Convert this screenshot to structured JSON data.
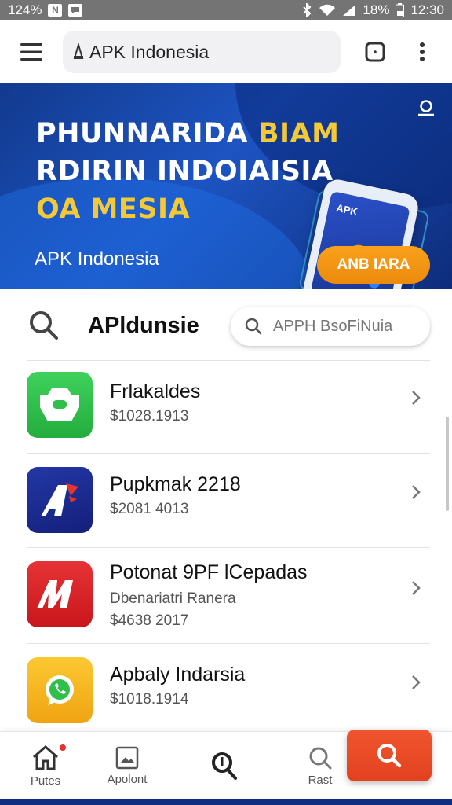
{
  "status_bar": {
    "left_text": "124%",
    "battery": "18%",
    "time": "12:30"
  },
  "app_bar": {
    "url_text": "APK Indonesia",
    "icons": [
      "menu-icon",
      "lock-icon",
      "tabs-icon",
      "more-vert-icon"
    ]
  },
  "banner": {
    "line1_white": "PHUNNARIDA ",
    "line1_yellow": "BIAM",
    "line2": "RDIRIN INDOIAISIA",
    "line3": "OA MESIA",
    "subtitle": "APK Indonesia",
    "cta_label": "ANB IARA",
    "phone_title": "APK",
    "colors": {
      "background": "#1d54c2",
      "accent_yellow": "#f3c938",
      "cta": "#f9a11c"
    }
  },
  "search": {
    "title": "APldunsie",
    "placeholder": "APPH BsoFiNuia"
  },
  "apps": [
    {
      "title": "Frlakaldes",
      "subtitle": "",
      "price": "$1028.1913",
      "icon_color": "#2fbf4a"
    },
    {
      "title": "Pupkmak 2218",
      "subtitle": "",
      "price": "$2081 4013",
      "icon_color": "#1c2a8f"
    },
    {
      "title": "Potonat 9PF lCepadas",
      "subtitle": "Dbenariatri Ranera",
      "price": "$4638 2017",
      "icon_color": "#d9262b"
    },
    {
      "title": "Apbaly Indarsia",
      "subtitle": "",
      "price": "$1018.1914",
      "icon_color": "#f5b81e"
    }
  ],
  "bottom_nav": {
    "items": [
      {
        "label": "Putes",
        "icon": "home-icon"
      },
      {
        "label": "Apolont",
        "icon": "gallery-icon"
      },
      {
        "label": "",
        "icon": "search-icon"
      },
      {
        "label": "Rast",
        "icon": "search-icon"
      }
    ],
    "fab_icon": "search-icon",
    "colors": {
      "fab": "#e2411f"
    }
  }
}
